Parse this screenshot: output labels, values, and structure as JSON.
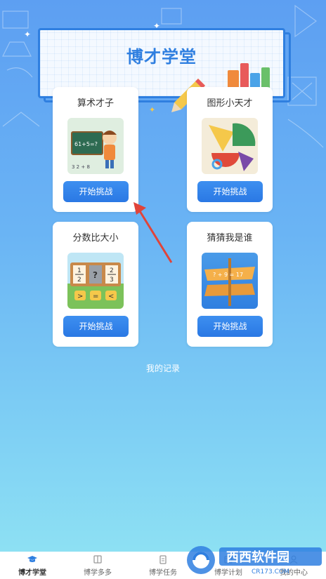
{
  "banner": {
    "title": "博才学堂"
  },
  "cards": [
    {
      "title": "算术才子",
      "button": "开始挑战"
    },
    {
      "title": "图形小天才",
      "button": "开始挑战"
    },
    {
      "title": "分数比大小",
      "button": "开始挑战"
    },
    {
      "title": "猜猜我是谁",
      "button": "开始挑战"
    }
  ],
  "images": {
    "arithmetic_board": "61+5=?",
    "fraction_left_num": "1",
    "fraction_left_den": "2",
    "fraction_mid": "?",
    "fraction_right_num": "2",
    "fraction_right_den": "3",
    "cmp_gt": ">",
    "cmp_eq": "=",
    "cmp_lt": "<",
    "guess_equation": "? + 9 = 17"
  },
  "records_link": "我的记录",
  "nav": [
    {
      "label": "博才学堂",
      "icon": "graduation-cap-icon"
    },
    {
      "label": "博学多多",
      "icon": "book-icon"
    },
    {
      "label": "博学任务",
      "icon": "clipboard-icon"
    },
    {
      "label": "博学计划",
      "icon": "calendar-icon"
    },
    {
      "label": "我的中心",
      "icon": "user-icon"
    }
  ],
  "watermark": {
    "brand": "西西软件园",
    "url": "CR173.COM"
  },
  "colors": {
    "accent": "#2f7fe0",
    "button": "#3d8ff0",
    "arrow": "#e0443a"
  }
}
